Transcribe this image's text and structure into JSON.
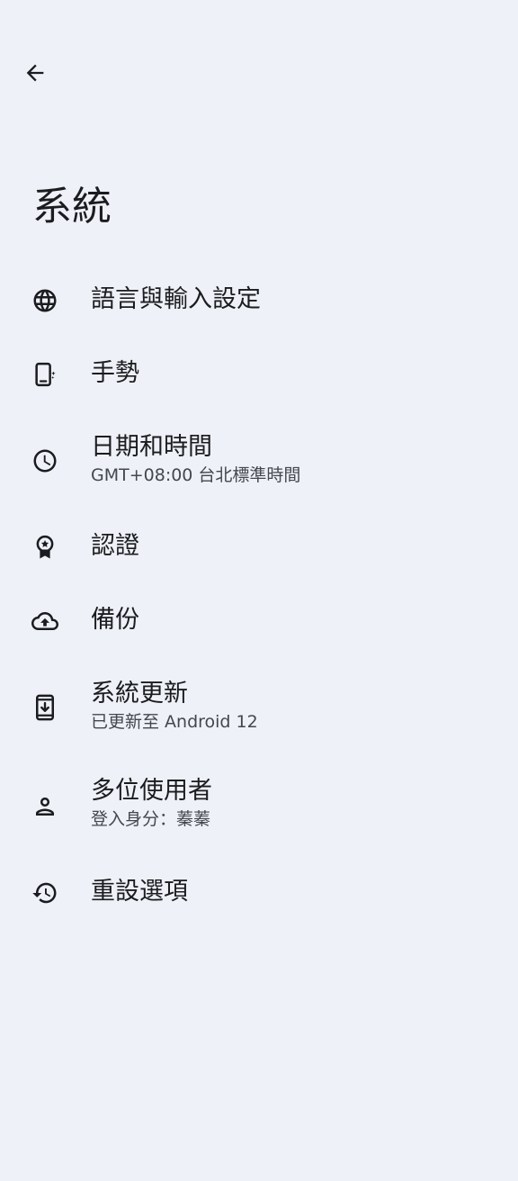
{
  "header": {
    "back_icon": "arrow-back-icon",
    "title": "系統"
  },
  "items": [
    {
      "key": "language",
      "icon": "globe-icon",
      "title": "語言與輸入設定",
      "subtitle": ""
    },
    {
      "key": "gestures",
      "icon": "phone-gesture-icon",
      "title": "手勢",
      "subtitle": ""
    },
    {
      "key": "datetime",
      "icon": "clock-icon",
      "title": "日期和時間",
      "subtitle": "GMT+08:00 台北標準時間"
    },
    {
      "key": "certification",
      "icon": "certification-badge-icon",
      "title": "認證",
      "subtitle": ""
    },
    {
      "key": "backup",
      "icon": "cloud-upload-icon",
      "title": "備份",
      "subtitle": ""
    },
    {
      "key": "system_update",
      "icon": "system-update-icon",
      "title": "系統更新",
      "subtitle": "已更新至 Android 12"
    },
    {
      "key": "users",
      "icon": "person-icon",
      "title": "多位使用者",
      "subtitle": "登入身分：蓁蓁"
    },
    {
      "key": "reset",
      "icon": "history-icon",
      "title": "重設選項",
      "subtitle": ""
    }
  ],
  "colors": {
    "background": "#eef1f7",
    "text_primary": "#1b1c1f",
    "text_secondary": "#44474e",
    "icon": "#1b1c1f"
  }
}
